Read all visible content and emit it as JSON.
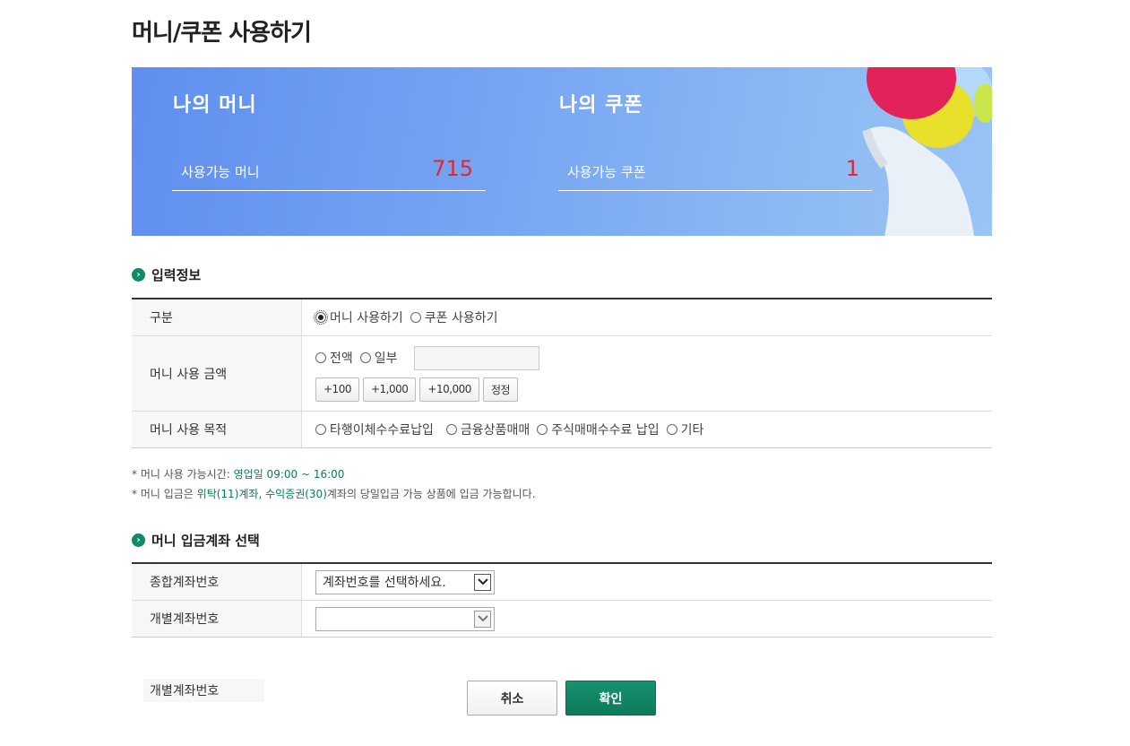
{
  "page": {
    "title": "머니/쿠폰 사용하기"
  },
  "banner": {
    "money": {
      "heading": "나의 머니",
      "label": "사용가능 머니",
      "value": "715"
    },
    "coupon": {
      "heading": "나의 쿠폰",
      "label": "사용가능 쿠폰",
      "value": "1"
    }
  },
  "input_section": {
    "title": "입력정보",
    "rows": {
      "type": {
        "label": "구분",
        "options": [
          "머니 사용하기",
          "쿠폰 사용하기"
        ],
        "selected": "머니 사용하기"
      },
      "amount": {
        "label": "머니 사용 금액",
        "options": [
          "전액",
          "일부"
        ],
        "input_value": "",
        "buttons": [
          "+100",
          "+1,000",
          "+10,000",
          "정정"
        ]
      },
      "purpose": {
        "label": "머니 사용 목적",
        "options": [
          "타행이체수수료납입",
          "금융상품매매",
          "주식매매수수료 납입",
          "기타"
        ]
      }
    }
  },
  "notes": {
    "line1_prefix": "* 머니 사용 가능시간: ",
    "line1_highlight": "영업일 09:00 ~ 16:00",
    "line2_prefix": "* 머니 입금은 ",
    "line2_highlight": "위탁(11)계좌, 수익증권(30)",
    "line2_suffix": "계좌의 당일입금 가능 상품에 입금 가능합니다."
  },
  "account_section": {
    "title": "머니 입금계좌 선택",
    "rows": {
      "master": {
        "label": "종합계좌번호",
        "select_value": "계좌번호를 선택하세요."
      },
      "sub": {
        "label": "개별계좌번호",
        "select_value": ""
      }
    }
  },
  "floating_label": "개별계좌번호",
  "buttons": {
    "cancel": "취소",
    "ok": "확인"
  },
  "colors": {
    "accent_green": "#0d7a5c",
    "value_red": "#e3262e",
    "banner_blue": "#6f9ef1"
  },
  "icons": {
    "section_bullet": "chevron-right-circle-icon",
    "select_arrow": "chevron-down-icon"
  }
}
